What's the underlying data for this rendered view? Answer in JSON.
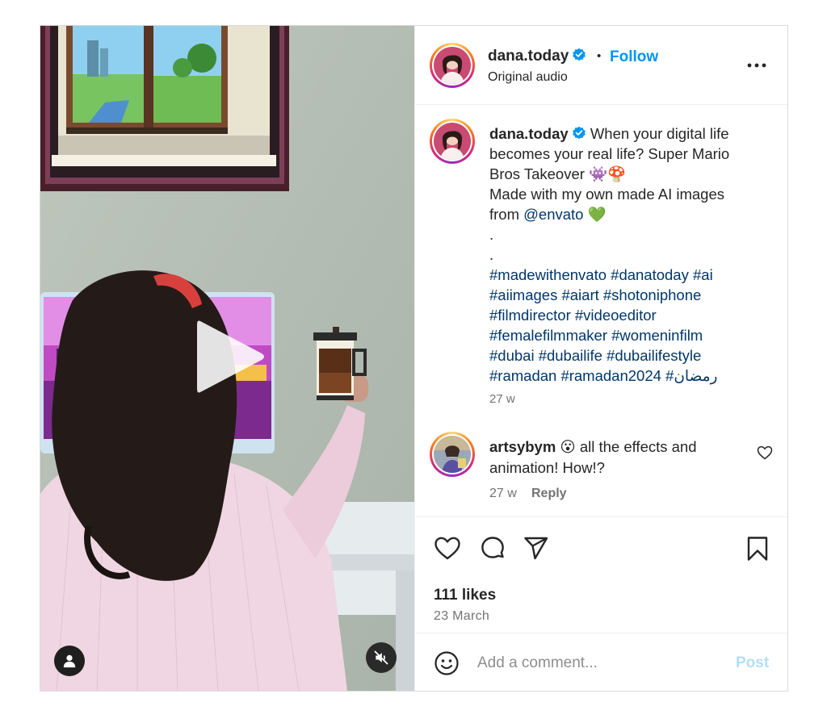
{
  "header": {
    "username": "dana.today",
    "separator": "•",
    "follow_label": "Follow",
    "audio_label": "Original audio",
    "more_icon": "more-horizontal-icon"
  },
  "caption": {
    "username": "dana.today",
    "line1_text": "When your digital life",
    "line2": "becomes your real life? Super Mario",
    "line3": "Bros Takeover 👾🍄",
    "line4": "Made with my own made AI images",
    "line5_prefix": "from ",
    "line5_mention": "@envato",
    "line5_suffix": " 💚",
    "dot1": ".",
    "dot2": ".",
    "hashtags_line1": "#madewithenvato #danatoday #ai",
    "hashtags_line2": "#aiimages #aiart #shotoniphone",
    "hashtags_line3": "#filmdirector #videoeditor",
    "hashtags_line4": "#femalefilmmaker #womeninfilm",
    "hashtags_line5": "#dubai #dubailife #dubailifestyle",
    "hashtags_line6": "#ramadan #ramadan2024 #رمضان",
    "time": "27 w"
  },
  "comment": {
    "username": "artsybym",
    "text_line1": "😮 all the effects and",
    "text_line2": "animation! How!?",
    "time": "27 w",
    "reply_label": "Reply"
  },
  "actions": {
    "likes": "111 likes",
    "date": "23 March"
  },
  "add_comment": {
    "placeholder": "Add a comment...",
    "post_label": "Post"
  },
  "colors": {
    "follow_blue": "#0095f6",
    "link_blue": "#00376b",
    "secondary_text": "#737373",
    "post_disabled": "#b2dffc",
    "verified_blue": "#0095f6"
  }
}
